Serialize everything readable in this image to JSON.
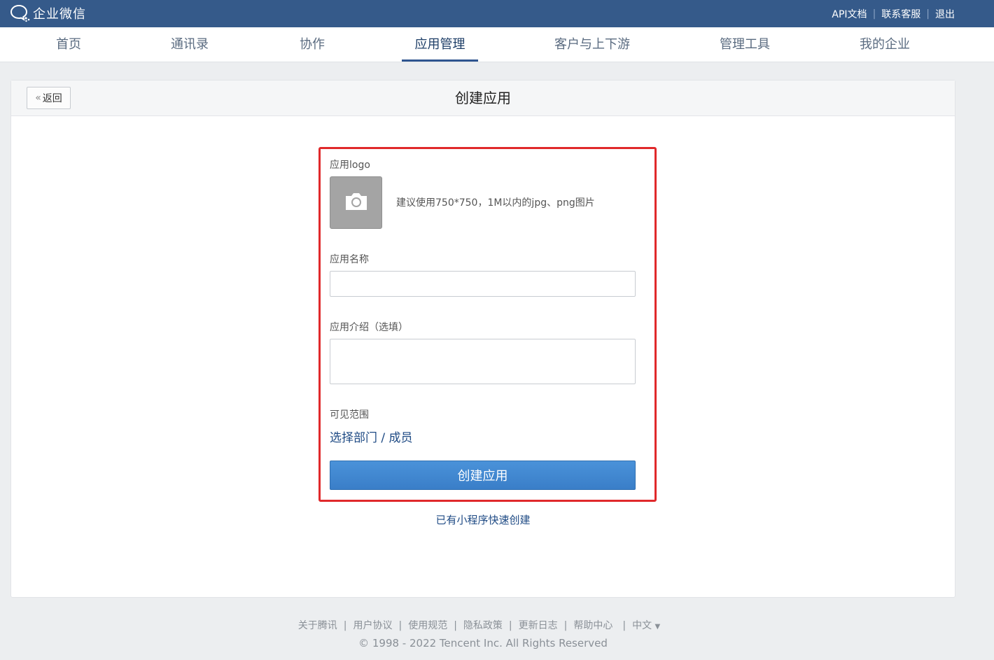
{
  "topbar": {
    "brand": "企业微信",
    "links": [
      {
        "label": "API文档"
      },
      {
        "label": "联系客服"
      },
      {
        "label": "退出"
      }
    ]
  },
  "nav": {
    "items": [
      {
        "label": "首页"
      },
      {
        "label": "通讯录"
      },
      {
        "label": "协作"
      },
      {
        "label": "应用管理",
        "active": true
      },
      {
        "label": "客户与上下游"
      },
      {
        "label": "管理工具"
      },
      {
        "label": "我的企业"
      }
    ]
  },
  "card": {
    "back_label": "返回",
    "title": "创建应用"
  },
  "form": {
    "logo_label": "应用logo",
    "logo_hint": "建议使用750*750，1M以内的jpg、png图片",
    "name_label": "应用名称",
    "name_value": "",
    "intro_label": "应用介绍（选填）",
    "intro_value": "",
    "visibility_label": "可见范围",
    "select_link": "选择部门 / 成员",
    "submit_label": "创建应用",
    "mini_program_link": "已有小程序快速创建"
  },
  "footer": {
    "links": [
      {
        "label": "关于腾讯"
      },
      {
        "label": "用户协议"
      },
      {
        "label": "使用规范"
      },
      {
        "label": "隐私政策"
      },
      {
        "label": "更新日志"
      },
      {
        "label": "帮助中心"
      }
    ],
    "language": "中文",
    "copyright": "© 1998 - 2022 Tencent Inc. All Rights Reserved"
  },
  "colors": {
    "topbar": "#355a8a",
    "accent": "#3a7ec8",
    "highlight": "#e0292b"
  }
}
